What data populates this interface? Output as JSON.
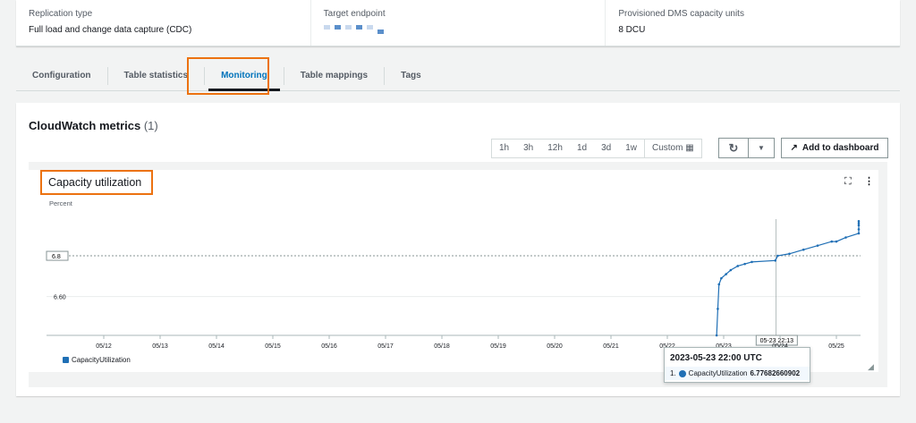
{
  "summary": [
    {
      "label": "Replication type",
      "value": "Full load and change data capture (CDC)"
    },
    {
      "label": "Target endpoint",
      "value": ""
    },
    {
      "label": "Provisioned DMS capacity units",
      "value": "8 DCU"
    }
  ],
  "tabs": [
    {
      "label": "Configuration"
    },
    {
      "label": "Table statistics"
    },
    {
      "label": "Monitoring",
      "active": true
    },
    {
      "label": "Table mappings"
    },
    {
      "label": "Tags"
    }
  ],
  "panel": {
    "title": "CloudWatch metrics",
    "count": "(1)"
  },
  "range": [
    "1h",
    "3h",
    "12h",
    "1d",
    "3d",
    "1w"
  ],
  "custom_label": "Custom",
  "add_dashboard": "Add to dashboard",
  "widget": {
    "title": "Capacity utilization",
    "unit": "Percent"
  },
  "accent": "#1f6fb5",
  "chart_data": {
    "type": "line",
    "ylabel": "Percent",
    "yticks": [
      "6.60"
    ],
    "threshold_label": "6.8",
    "xticks": [
      "05/12",
      "05/13",
      "05/14",
      "05/15",
      "05/16",
      "05/17",
      "05/18",
      "05/19",
      "05/20",
      "05/21",
      "05/22",
      "05/23",
      "05/24",
      "05/25"
    ],
    "xlim": [
      "2023-05-11T12:00",
      "2023-05-25T10:00"
    ],
    "ylim": [
      6.41,
      6.98
    ],
    "series": [
      {
        "name": "CapacityUtilization",
        "points": [
          [
            "2023-05-22T21:00",
            6.41
          ],
          [
            "2023-05-22T21:30",
            6.54
          ],
          [
            "2023-05-22T22:00",
            6.66
          ],
          [
            "2023-05-22T23:00",
            6.69
          ],
          [
            "2023-05-23T01:00",
            6.71
          ],
          [
            "2023-05-23T03:00",
            6.73
          ],
          [
            "2023-05-23T06:00",
            6.75
          ],
          [
            "2023-05-23T09:00",
            6.76
          ],
          [
            "2023-05-23T12:00",
            6.77
          ],
          [
            "2023-05-23T22:00",
            6.7768
          ],
          [
            "2023-05-23T23:00",
            6.8
          ],
          [
            "2023-05-24T04:00",
            6.81
          ],
          [
            "2023-05-24T10:00",
            6.83
          ],
          [
            "2023-05-24T16:00",
            6.85
          ],
          [
            "2023-05-24T22:00",
            6.87
          ],
          [
            "2023-05-25T00:00",
            6.87
          ],
          [
            "2023-05-25T04:00",
            6.89
          ],
          [
            "2023-05-25T12:00",
            6.91
          ],
          [
            "2023-05-25T20:00",
            6.93
          ],
          [
            "2023-05-26T04:00",
            6.95
          ],
          [
            "2023-05-26T12:00",
            6.96
          ],
          [
            "2023-05-26T20:00",
            6.97
          ]
        ]
      }
    ],
    "cursor_label": "05-23 22:13",
    "tooltip": {
      "time": "2023-05-23 22:00 UTC",
      "index": "1.",
      "series": "CapacityUtilization",
      "value": "6.77682660902"
    },
    "legend": "bottom-left"
  }
}
